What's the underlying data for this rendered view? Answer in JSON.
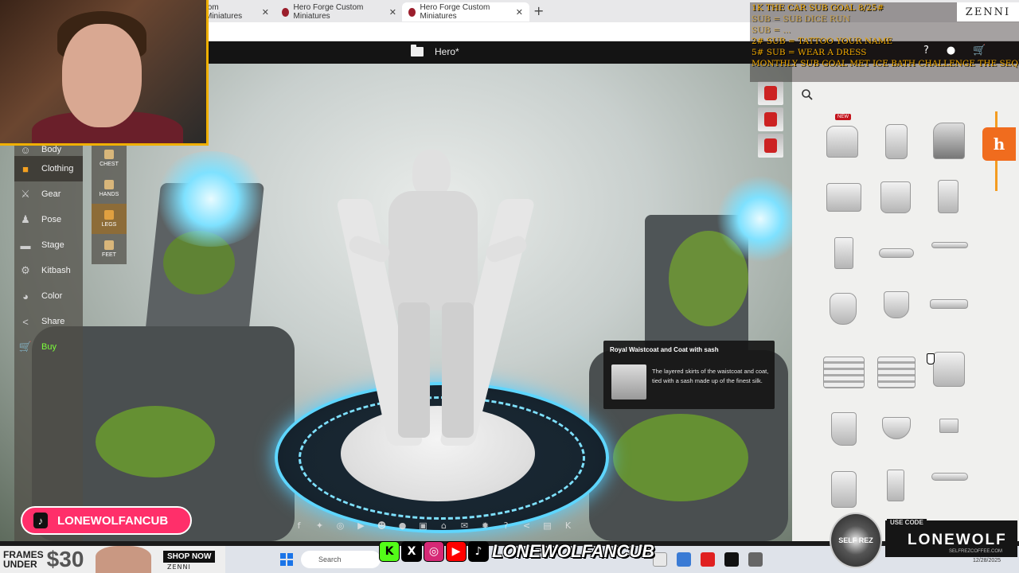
{
  "browser": {
    "tabs": [
      {
        "label": "tom Miniatures",
        "active": false
      },
      {
        "label": "Hero Forge Custom Miniatures",
        "active": false
      },
      {
        "label": "Hero Forge Custom Miniatures",
        "active": true
      }
    ],
    "new_tab_glyph": "+",
    "close_glyph": "✕"
  },
  "app": {
    "title": "Hero*",
    "header_icons": [
      "help-icon",
      "account-icon",
      "cart-icon"
    ]
  },
  "left_nav": {
    "items": [
      {
        "label": "Body",
        "icon": "body-icon",
        "active": false
      },
      {
        "label": "Clothing",
        "icon": "shirt-icon",
        "active": true
      },
      {
        "label": "Gear",
        "icon": "sword-icon",
        "active": false
      },
      {
        "label": "Pose",
        "icon": "pose-icon",
        "active": false
      },
      {
        "label": "Stage",
        "icon": "stage-icon",
        "active": false
      },
      {
        "label": "Kitbash",
        "icon": "kitbash-icon",
        "active": false
      },
      {
        "label": "Color",
        "icon": "palette-icon",
        "active": false
      },
      {
        "label": "Share",
        "icon": "share-icon",
        "active": false
      },
      {
        "label": "Buy",
        "icon": "cart-icon",
        "active": false
      }
    ]
  },
  "sub_nav": {
    "items": [
      {
        "label": "CHEST",
        "active": false
      },
      {
        "label": "HANDS",
        "active": false
      },
      {
        "label": "LEGS",
        "active": true
      },
      {
        "label": "FEET",
        "active": false
      }
    ]
  },
  "right_panel": {
    "new_badge": "NEW",
    "hf_button": "h",
    "items_count_rows": 7
  },
  "tooltip": {
    "title": "Royal Waistcoat and Coat with sash",
    "description": "The layered skirts of the waistcoat and coat, tied with a sash made up of the finest silk."
  },
  "overlay": {
    "sub_goal_lines": [
      "1K THE CAR SUB GOAL 8/25#",
      "  SUB = SUB DICE RUN",
      "  SUB = ...",
      "2# SUB = TATTOO YOUR NAME",
      "5# SUB = WEAR A DRESS",
      "MONTHLY SUB GOAL MET ICE BATH CHALLENGE THE SEQUEL"
    ],
    "zenni_logo": "ZENNI",
    "tiktok_handle": "LONEWOLFANCUB",
    "social_handle": "LONEWOLFANCUB",
    "promo": {
      "use_code_label": "USE CODE",
      "code": "LONEWOLF",
      "site": "SELFREZCOFFEE.COM",
      "brand": "SELF REZ"
    },
    "ad": {
      "line1": "FRAMES",
      "line2": "UNDER",
      "price": "$30",
      "shop_now": "SHOP NOW",
      "brand": "ZENNI"
    }
  },
  "taskbar": {
    "search_placeholder": "Search",
    "date": "12/28/2025"
  },
  "colors": {
    "accent_orange": "#f06c1e",
    "buy_green": "#55e020",
    "tiktok_pink": "#ff2f6a",
    "platform_glow": "#5ed6ff"
  }
}
